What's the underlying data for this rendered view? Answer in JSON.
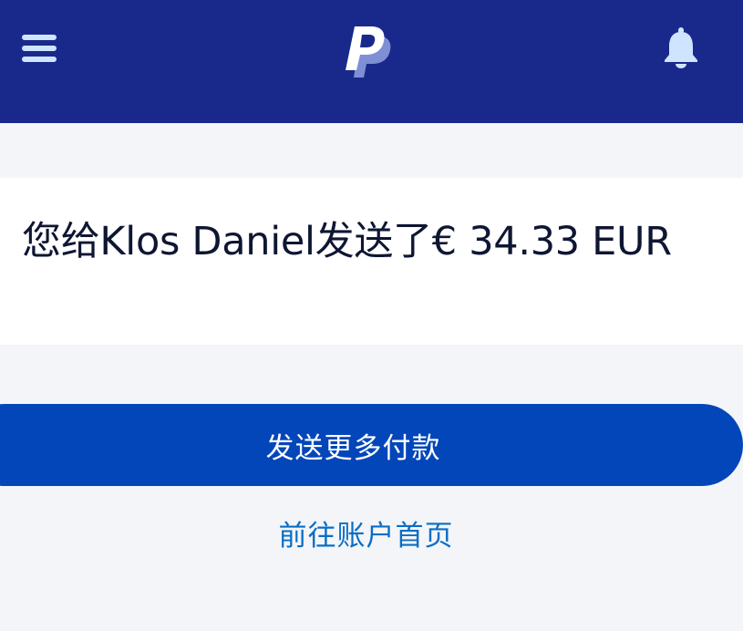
{
  "header": {
    "menu_icon": "hamburger-menu-icon",
    "logo_icon": "paypal-logo",
    "bell_icon": "bell-icon",
    "colors": {
      "background": "#19298b",
      "icons": "#cfe5ff"
    }
  },
  "confirmation": {
    "message": "您给Klos Daniel发送了€ 34.33 EUR"
  },
  "actions": {
    "send_more_label": "发送更多付款",
    "go_home_label": "前往账户首页",
    "colors": {
      "primary_button": "#0346b9",
      "link": "#0a6ec4"
    }
  }
}
